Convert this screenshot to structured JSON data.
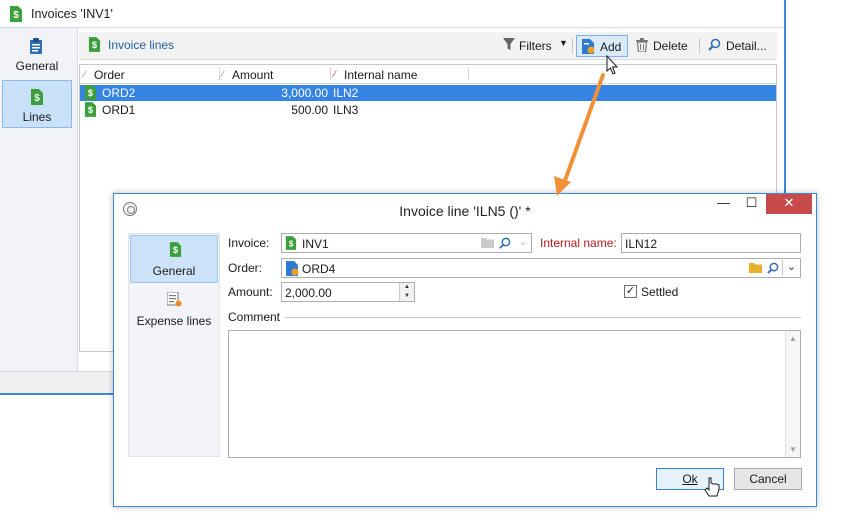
{
  "bg_window": {
    "title": "Invoices 'INV1'",
    "nav": [
      {
        "label": "General",
        "icon": "clipboard-icon",
        "selected": false
      },
      {
        "label": "Lines",
        "icon": "dollar-doc-icon",
        "selected": true
      }
    ],
    "toolbar": {
      "title": "Invoice lines",
      "filters": "Filters",
      "add": "Add",
      "delete": "Delete",
      "detail": "Detail..."
    },
    "grid": {
      "columns": [
        "Order",
        "Amount",
        "Internal name"
      ],
      "rows": [
        {
          "order": "ORD2",
          "amount": "3,000.00",
          "internal_name": "ILN2",
          "selected": true
        },
        {
          "order": "ORD1",
          "amount": "500.00",
          "internal_name": "ILN3",
          "selected": false
        }
      ]
    }
  },
  "dialog": {
    "title": "Invoice line 'ILN5 ()' *",
    "window_buttons": {
      "minimize": "—",
      "maximize": "☐",
      "close": "✕"
    },
    "nav": [
      {
        "label": "General",
        "icon": "dollar-doc-icon",
        "selected": true
      },
      {
        "label": "Expense lines",
        "icon": "expense-lines-icon",
        "selected": false
      }
    ],
    "form": {
      "invoice_label": "Invoice:",
      "invoice_value": "INV1",
      "internal_name_label": "Internal name:",
      "internal_name_value": "ILN12",
      "order_label": "Order:",
      "order_value": "ORD4",
      "amount_label": "Amount:",
      "amount_value": "2,000.00",
      "settled_label": "Settled",
      "settled_checked": true,
      "comment_label": "Comment",
      "comment_value": ""
    },
    "buttons": {
      "ok": "Ok",
      "cancel": "Cancel"
    }
  },
  "colors": {
    "accent": "#3584e4",
    "window_border": "#3c88d6",
    "arrow": "#f0913a",
    "required_label": "#b31b1b",
    "close_button": "#c74b4b"
  }
}
